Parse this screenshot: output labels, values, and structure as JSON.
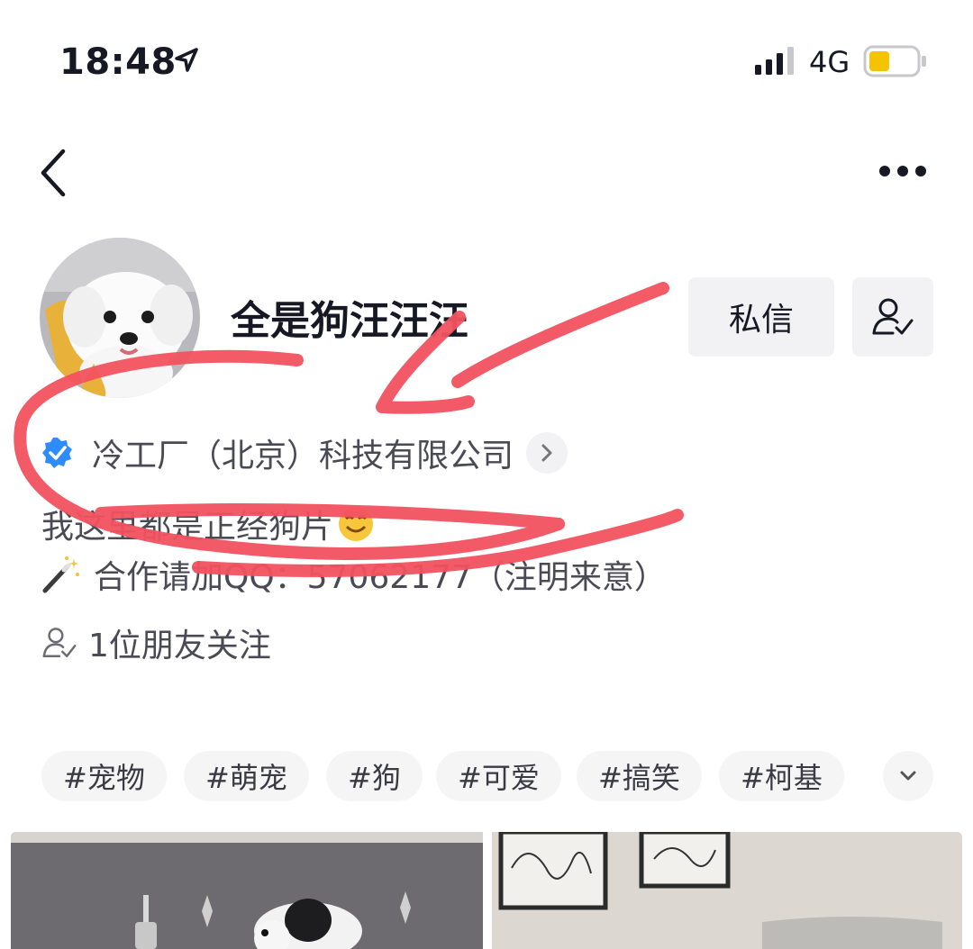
{
  "status_bar": {
    "time": "18:48",
    "network": "4G",
    "battery_color": "#f5c400"
  },
  "nav": {
    "back_icon": "chevron-left-icon",
    "more_icon": "ellipsis-icon"
  },
  "profile": {
    "username": "全是狗汪汪汪",
    "message_button": "私信",
    "verification": "冷工厂（北京）科技有限公司",
    "bio_line1": "我这里都是正经狗片",
    "bio_line2": "合作请加QQ：57062177（注明来意）",
    "friends_following": "1位朋友关注"
  },
  "tags": [
    "#宠物",
    "#萌宠",
    "#狗",
    "#可爱",
    "#搞笑",
    "#柯基"
  ],
  "colors": {
    "annotation_red": "#f2525f",
    "verified_blue": "#2f8cff"
  }
}
